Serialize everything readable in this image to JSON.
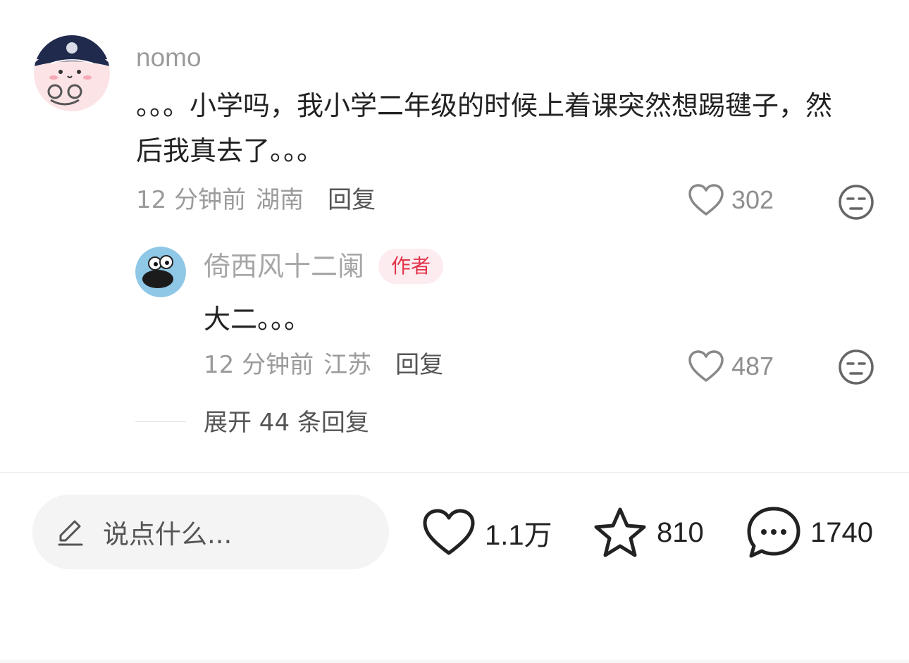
{
  "comment": {
    "username": "nomo",
    "text": "。。。小学吗，我小学二年级的时候上着课突然想踢毽子，然后我真去了。。。",
    "time": "12 分钟前",
    "location": "湖南",
    "reply_label": "回复",
    "likes": "302"
  },
  "reply": {
    "username": "倚西风十二阑",
    "badge": "作者",
    "text": "大二。。。",
    "time": "12 分钟前",
    "location": "江苏",
    "reply_label": "回复",
    "likes": "487"
  },
  "expand_label": "展开 44 条回复",
  "bottom_bar": {
    "input_placeholder": "说点什么...",
    "likes": "1.1万",
    "stars": "810",
    "comments": "1740"
  },
  "colors": {
    "badge_bg": "#fdecef",
    "badge_text": "#e2334a",
    "meta_gray": "#9b9b9b"
  }
}
